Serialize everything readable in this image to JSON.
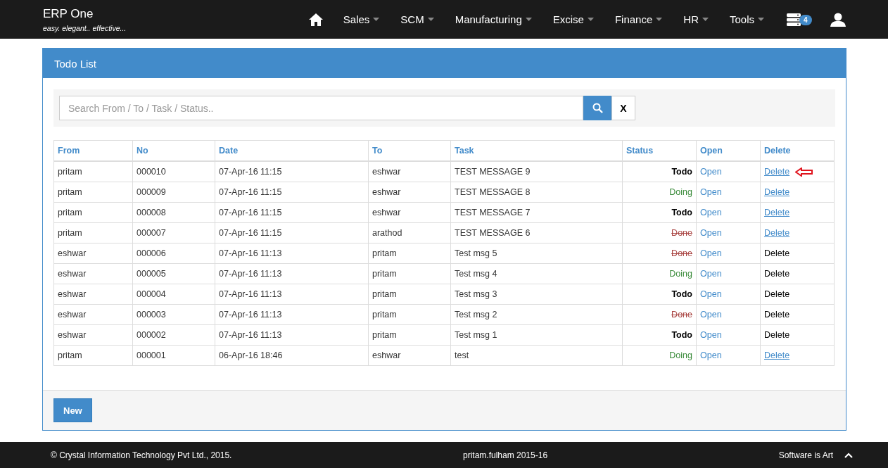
{
  "brand": {
    "title": "ERP One",
    "tagline": "easy. elegant.. effective..."
  },
  "nav": [
    {
      "label": "Sales"
    },
    {
      "label": "SCM"
    },
    {
      "label": "Manufacturing"
    },
    {
      "label": "Excise"
    },
    {
      "label": "Finance"
    },
    {
      "label": "HR"
    },
    {
      "label": "Tools"
    }
  ],
  "notifications": {
    "count": "4"
  },
  "panel": {
    "title": "Todo List"
  },
  "search": {
    "placeholder": "Search From / To / Task / Status..",
    "clear": "X"
  },
  "table": {
    "columns": [
      "From",
      "No",
      "Date",
      "To",
      "Task",
      "Status",
      "Open",
      "Delete"
    ],
    "rows": [
      {
        "from": "pritam",
        "no": "000010",
        "date": "07-Apr-16 11:15",
        "to": "eshwar",
        "task": "TEST MESSAGE 9",
        "status": {
          "text": "Todo",
          "kind": "todo"
        },
        "open": "Open",
        "delete": "Delete",
        "delete_linked": true,
        "marked": true
      },
      {
        "from": "pritam",
        "no": "000009",
        "date": "07-Apr-16 11:15",
        "to": "eshwar",
        "task": "TEST MESSAGE 8",
        "status": {
          "text": "Doing",
          "kind": "doing"
        },
        "open": "Open",
        "delete": "Delete",
        "delete_linked": true,
        "marked": false
      },
      {
        "from": "pritam",
        "no": "000008",
        "date": "07-Apr-16 11:15",
        "to": "eshwar",
        "task": "TEST MESSAGE 7",
        "status": {
          "text": "Todo",
          "kind": "todo"
        },
        "open": "Open",
        "delete": "Delete",
        "delete_linked": true,
        "marked": false
      },
      {
        "from": "pritam",
        "no": "000007",
        "date": "07-Apr-16 11:15",
        "to": "arathod",
        "task": "TEST MESSAGE 6",
        "status": {
          "text": "Done",
          "kind": "done"
        },
        "open": "Open",
        "delete": "Delete",
        "delete_linked": true,
        "marked": false
      },
      {
        "from": "eshwar",
        "no": "000006",
        "date": "07-Apr-16 11:13",
        "to": "pritam",
        "task": "Test msg 5",
        "status": {
          "text": "Done",
          "kind": "done"
        },
        "open": "Open",
        "delete": "Delete",
        "delete_linked": false,
        "marked": false
      },
      {
        "from": "eshwar",
        "no": "000005",
        "date": "07-Apr-16 11:13",
        "to": "pritam",
        "task": "Test msg 4",
        "status": {
          "text": "Doing",
          "kind": "doing"
        },
        "open": "Open",
        "delete": "Delete",
        "delete_linked": false,
        "marked": false
      },
      {
        "from": "eshwar",
        "no": "000004",
        "date": "07-Apr-16 11:13",
        "to": "pritam",
        "task": "Test msg 3",
        "status": {
          "text": "Todo",
          "kind": "todo"
        },
        "open": "Open",
        "delete": "Delete",
        "delete_linked": false,
        "marked": false
      },
      {
        "from": "eshwar",
        "no": "000003",
        "date": "07-Apr-16 11:13",
        "to": "pritam",
        "task": "Test msg 2",
        "status": {
          "text": "Done",
          "kind": "done"
        },
        "open": "Open",
        "delete": "Delete",
        "delete_linked": false,
        "marked": false
      },
      {
        "from": "eshwar",
        "no": "000002",
        "date": "07-Apr-16 11:13",
        "to": "pritam",
        "task": "Test msg 1",
        "status": {
          "text": "Todo",
          "kind": "todo"
        },
        "open": "Open",
        "delete": "Delete",
        "delete_linked": false,
        "marked": false
      },
      {
        "from": "pritam",
        "no": "000001",
        "date": "06-Apr-16 18:46",
        "to": "eshwar",
        "task": "test",
        "status": {
          "text": "Doing",
          "kind": "doing"
        },
        "open": "Open",
        "delete": "Delete",
        "delete_linked": true,
        "marked": false
      }
    ]
  },
  "new_button": "New",
  "footer": {
    "copyright": "© Crystal Information Technology Pvt Ltd., 2015.",
    "user": "pritam.fulham 2015-16",
    "motto": "Software is Art"
  }
}
